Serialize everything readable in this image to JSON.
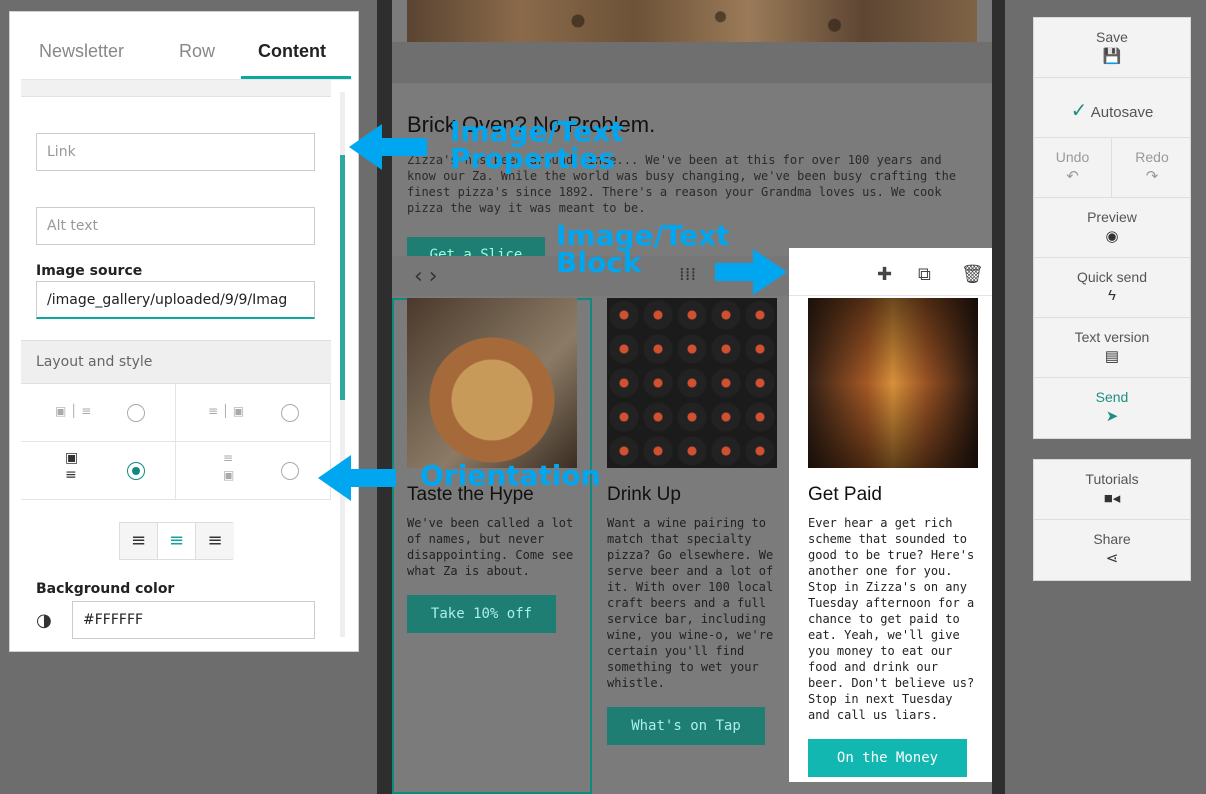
{
  "panel": {
    "tabs": [
      "Newsletter",
      "Row",
      "Content"
    ],
    "active_tab": "Content",
    "link_placeholder": "Link",
    "alt_placeholder": "Alt text",
    "image_source_label": "Image source",
    "image_source_value": "/image_gallery/uploaded/9/9/Imag",
    "layout_heading": "Layout and style",
    "selected_layout": "image-top-text-bottom",
    "background_color_label": "Background color",
    "background_color_value": "#FFFFFF"
  },
  "email": {
    "intro_title": "Brick Oven? No Problem.",
    "intro_text": "Zizza's has been around since... We've been at this for over 100 years and know our Za. While the world was busy changing, we've been busy crafting the finest pizza's since 1892. There's a reason your Grandma loves us. We cook pizza the way it was meant to be.",
    "intro_button": "Get a Slice",
    "columns": [
      {
        "title": "Taste the Hype",
        "text": "We've been called a lot of names, but never disappointing. Come see what Za is about.",
        "button": "Take 10% off"
      },
      {
        "title": "Drink Up",
        "text": "Want a wine pairing to match that specialty pizza? Go elsewhere. We serve beer and a lot of it. With over 100 local craft beers and a full service bar, including wine, you wine-o, we're certain you'll find something to wet your whistle.",
        "button": "What's on Tap"
      },
      {
        "title": "Get Paid",
        "text": "Ever hear a get rich scheme that sounded to good to be true? Here's another one for you. Stop in Zizza's on any Tuesday afternoon for a chance to get paid to eat. Yeah, we'll give you money to eat our food and drink our beer. Don't believe us? Stop in next Tuesday and call us liars.",
        "button": "On the Money"
      }
    ]
  },
  "sidebar": {
    "save": "Save",
    "autosave": "Autosave",
    "undo": "Undo",
    "redo": "Redo",
    "preview": "Preview",
    "quick_send": "Quick send",
    "text_version": "Text version",
    "send": "Send",
    "tutorials": "Tutorials",
    "share": "Share"
  },
  "annotations": {
    "properties": "Image/Text Properties",
    "block": "Image/Text Block",
    "orientation": "Orientation"
  },
  "colors": {
    "accent": "#0da6a0",
    "annotation": "#00a7f0",
    "button_dark": "#1f7e74",
    "button_active": "#11b7b0"
  }
}
